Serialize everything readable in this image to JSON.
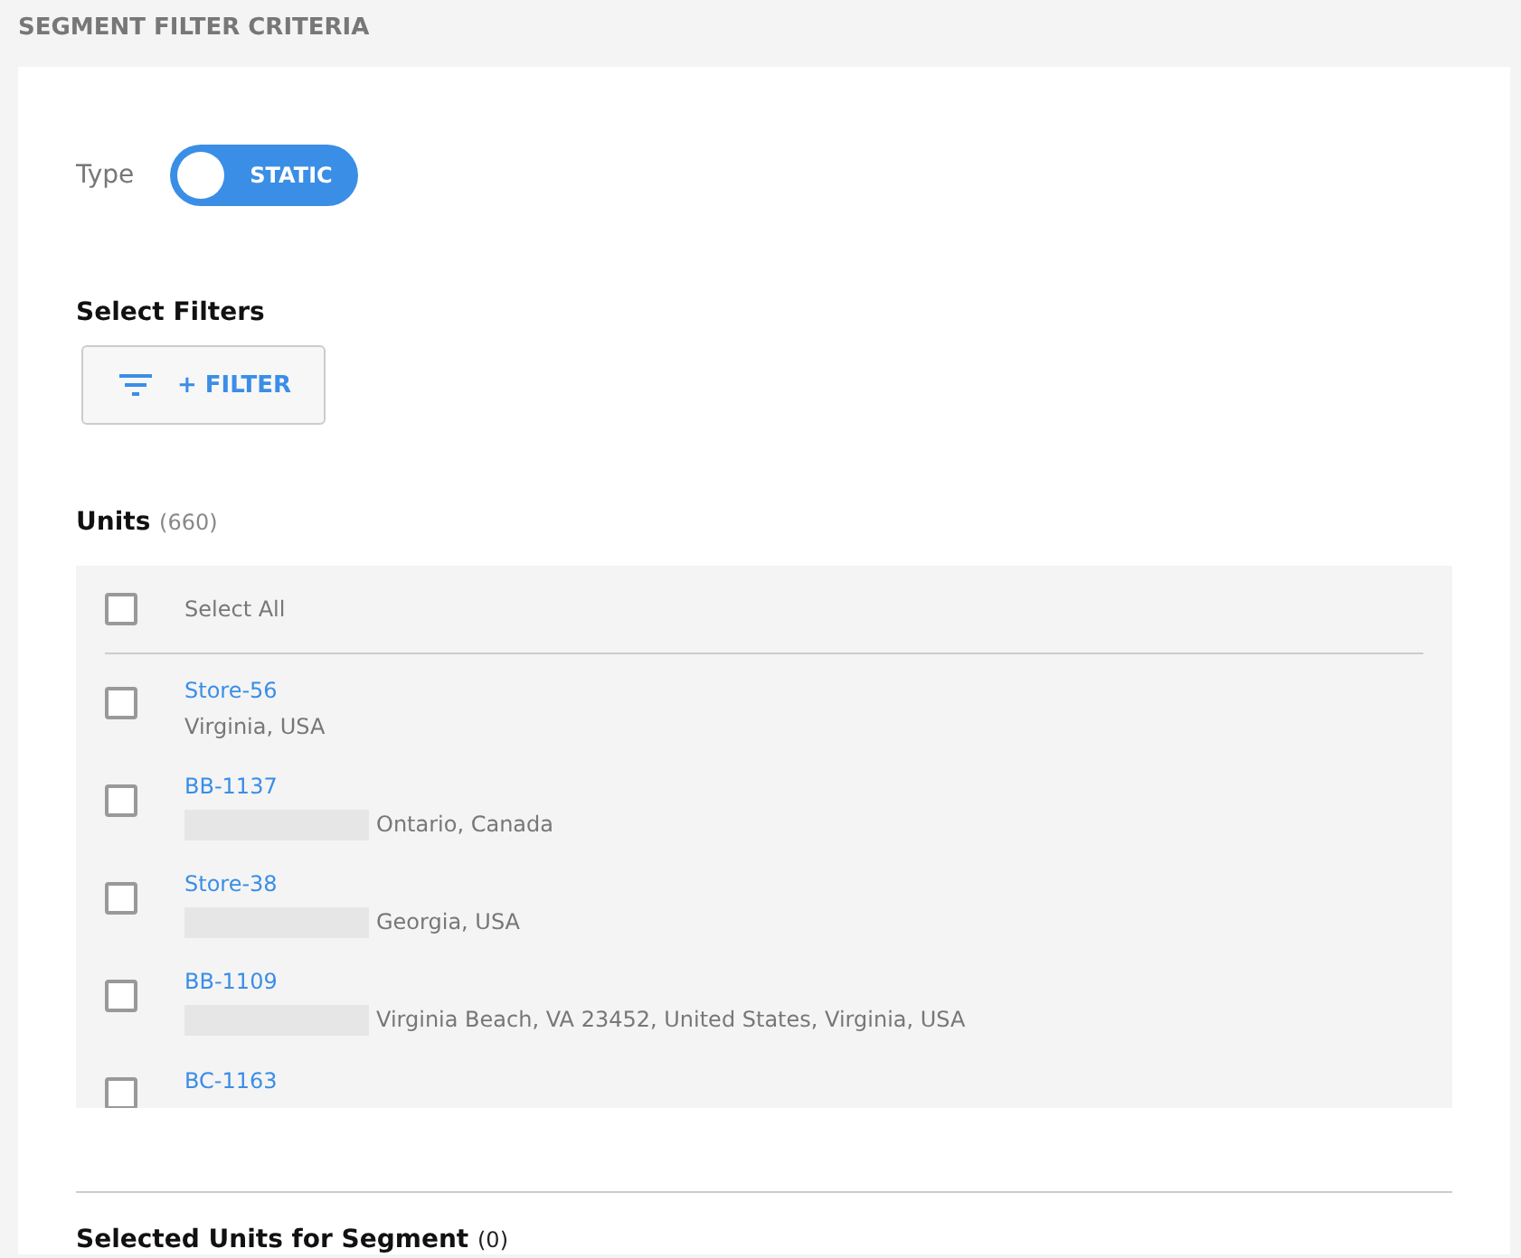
{
  "title": "SEGMENT FILTER CRITERIA",
  "type": {
    "label": "Type",
    "toggle": "STATIC"
  },
  "filters": {
    "heading": "Select Filters",
    "button": "+ FILTER"
  },
  "units": {
    "heading": "Units",
    "count": "(660)",
    "select_all": {
      "label": "Select All",
      "checked": false
    },
    "rows": [
      {
        "name": "Store-56",
        "address": "Virginia, USA",
        "redacted": false,
        "checked": false
      },
      {
        "name": "BB-1137",
        "address": "Ontario, Canada",
        "redacted": true,
        "checked": false
      },
      {
        "name": "Store-38",
        "address": "Georgia, USA",
        "redacted": true,
        "checked": false
      },
      {
        "name": "BB-1109",
        "address": "Virginia Beach, VA 23452, United States, Virginia, USA",
        "redacted": true,
        "checked": false
      },
      {
        "name": "BC-1163",
        "redacted": false,
        "checked": false
      }
    ]
  },
  "selected": {
    "heading": "Selected Units for Segment",
    "count": "(0)"
  }
}
